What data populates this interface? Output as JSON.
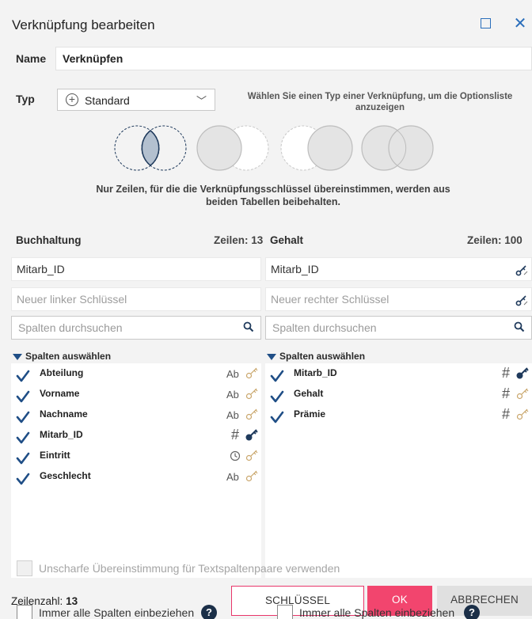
{
  "dialog": {
    "title": "Verknüpfung bearbeiten"
  },
  "name_field": {
    "label": "Name",
    "value": "Verknüpfen"
  },
  "type_field": {
    "label": "Typ",
    "selected": "Standard",
    "hint": "Wählen Sie einen Typ einer Verknüpfung, um die Optionsliste anzuzeigen",
    "description": "Nur Zeilen, für die die Verknüpfungsschlüssel übereinstimmen, werden aus beiden Tabellen beibehalten."
  },
  "join_types": [
    "inner-join-icon",
    "left-join-icon",
    "right-join-icon",
    "full-join-icon"
  ],
  "left": {
    "table": "Buchhaltung",
    "rows_label": "Zeilen: 13",
    "key": "Mitarb_ID",
    "new_key_placeholder": "Neuer linker Schlüssel",
    "search_placeholder": "Spalten durchsuchen",
    "select_columns_label": "Spalten auswählen",
    "columns": [
      {
        "name": "Abteilung",
        "type": "Ab",
        "is_key": false
      },
      {
        "name": "Vorname",
        "type": "Ab",
        "is_key": false
      },
      {
        "name": "Nachname",
        "type": "Ab",
        "is_key": false
      },
      {
        "name": "Mitarb_ID",
        "type": "#",
        "is_key": true
      },
      {
        "name": "Eintritt",
        "type": "clock",
        "is_key": false
      },
      {
        "name": "Geschlecht",
        "type": "Ab",
        "is_key": false
      }
    ],
    "include_all_label": "Immer alle Spalten einbeziehen"
  },
  "right": {
    "table": "Gehalt",
    "rows_label": "Zeilen: 100",
    "key": "Mitarb_ID",
    "new_key_placeholder": "Neuer rechter Schlüssel",
    "search_placeholder": "Spalten durchsuchen",
    "select_columns_label": "Spalten auswählen",
    "columns": [
      {
        "name": "Mitarb_ID",
        "type": "#",
        "is_key": true
      },
      {
        "name": "Gehalt",
        "type": "#",
        "is_key": false
      },
      {
        "name": "Prämie",
        "type": "#",
        "is_key": false
      }
    ],
    "include_all_label": "Immer alle Spalten einbeziehen"
  },
  "fuzzy_label": "Unscharfe Übereinstimmung für Textspaltenpaare verwenden",
  "footer": {
    "row_count_label": "Zeilenzahl:",
    "row_count_value": "13",
    "suggest_button": "SCHLÜSSEL EMPFEHLEN",
    "ok_button": "OK",
    "cancel_button": "ABBRECHEN"
  },
  "colors": {
    "accent": "#f2456e",
    "check": "#1f4e86",
    "help": "#1b2f48"
  }
}
